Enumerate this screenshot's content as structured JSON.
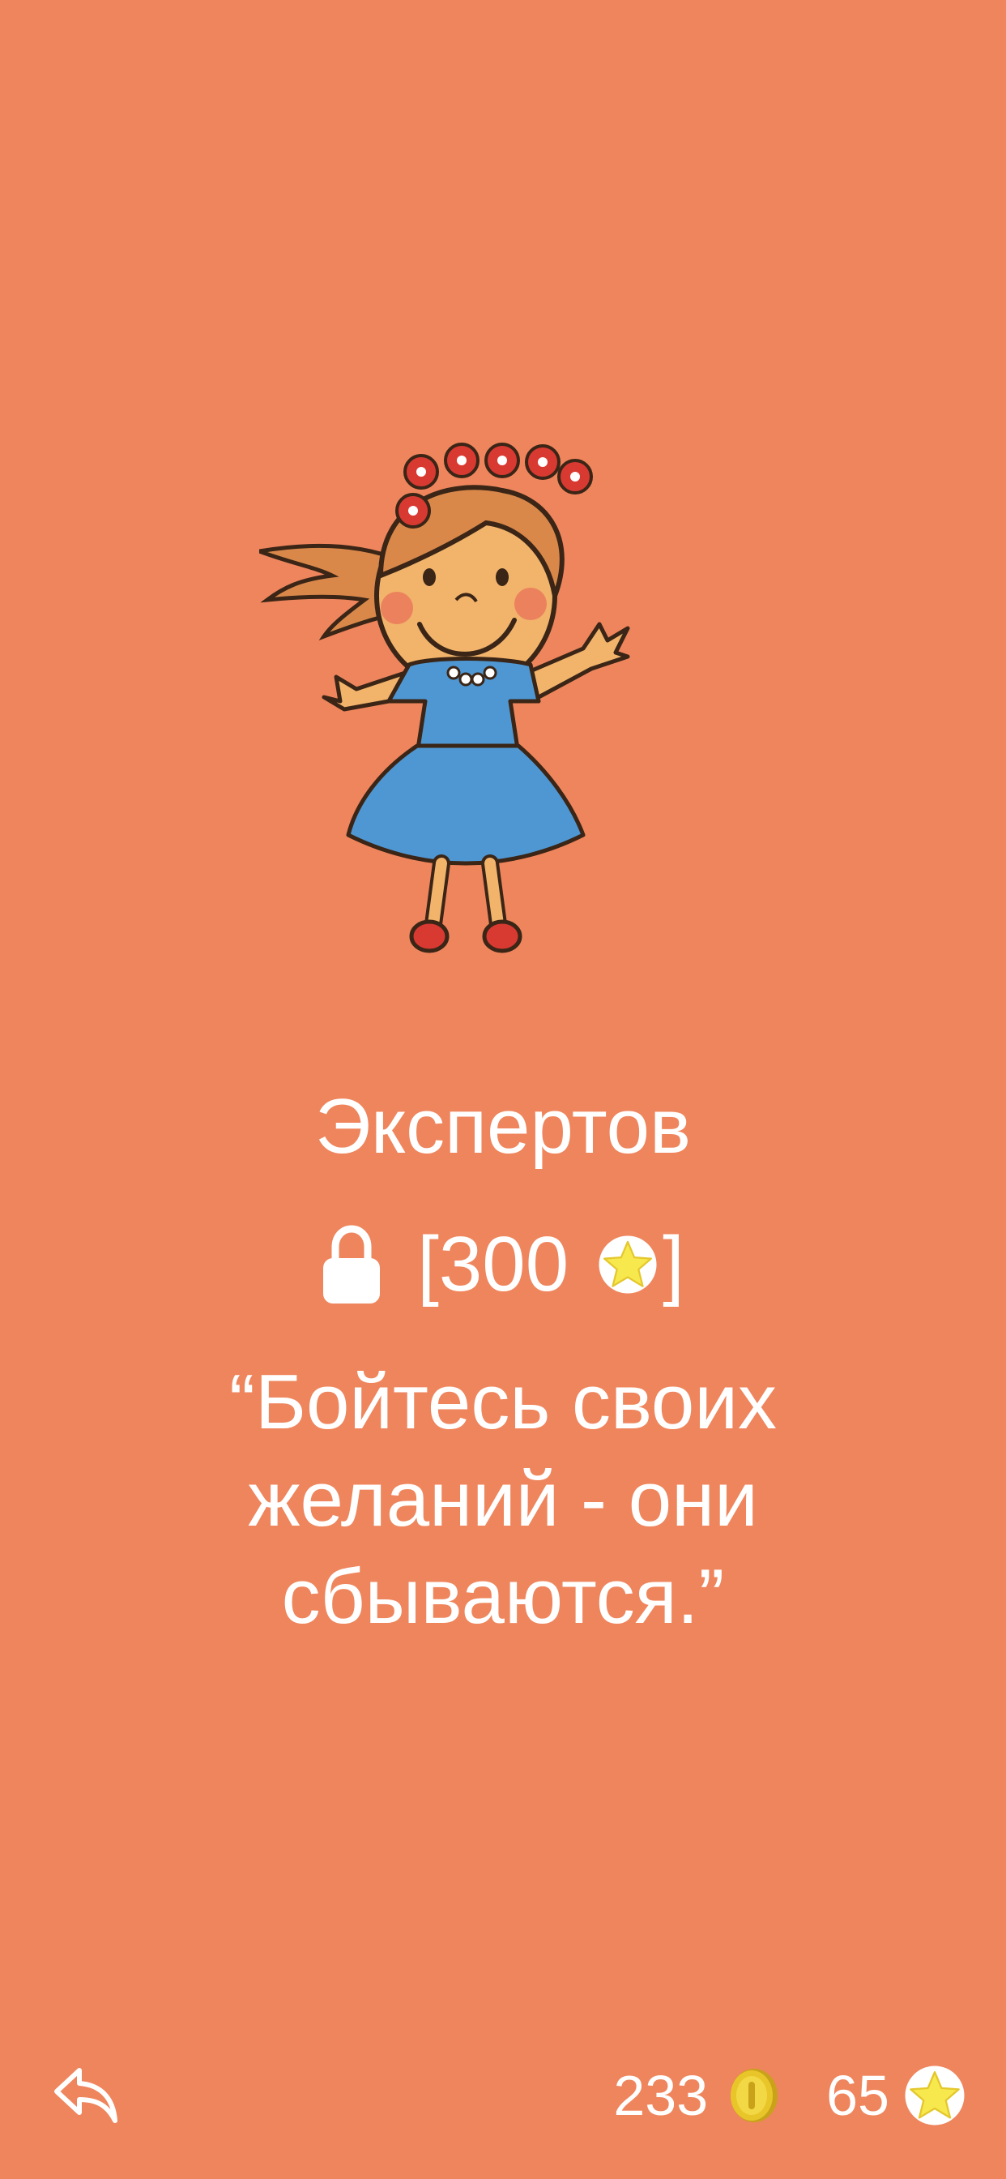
{
  "level": {
    "title": "Экспертов",
    "unlock_cost": "[300",
    "unlock_close": "]"
  },
  "quote": {
    "line1": "“Бойтесь своих",
    "line2": "желаний - они",
    "line3": "сбываются.”"
  },
  "stats": {
    "coins": "233",
    "stars": "65"
  },
  "icons": {
    "back": "back-arrow-icon",
    "lock": "lock-icon",
    "star": "star-icon",
    "coin": "coin-icon"
  },
  "colors": {
    "background": "#EF855C",
    "text": "#FFFFFF",
    "star": "#F7E84E",
    "coin": "#E8C62A"
  }
}
